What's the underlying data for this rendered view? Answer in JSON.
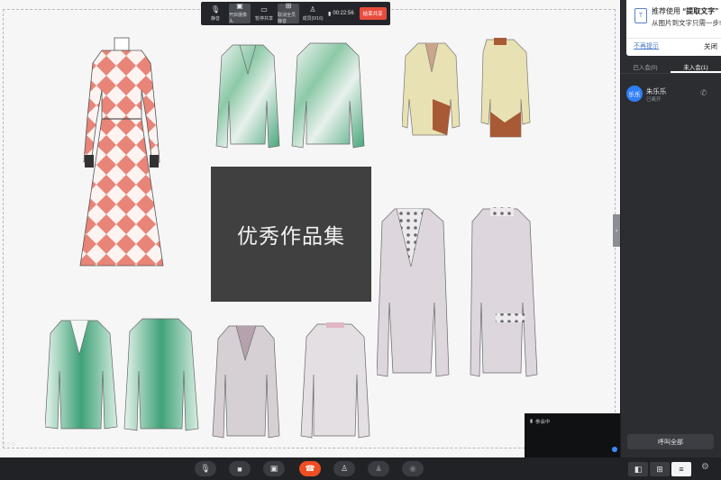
{
  "toolbar": {
    "buttons": [
      {
        "label": "静音",
        "icon": "mic-icon"
      },
      {
        "label": "开启摄像头",
        "icon": "camera-icon"
      },
      {
        "label": "暂停共享",
        "icon": "pause-share-icon"
      },
      {
        "label": "取消全员静音",
        "icon": "unmute-all-icon"
      },
      {
        "label": "成员(0/16)",
        "icon": "members-icon"
      }
    ],
    "timer": "00:22:56",
    "end_label": "结束共享"
  },
  "shared_screen": {
    "portfolio_title": "优秀作品集",
    "colors": {
      "card": "#404040",
      "coral": "#e88478",
      "green": "#3fa277",
      "beige": "#e8e1b3",
      "brown": "#a85a35",
      "mauve": "#c8bcc4"
    }
  },
  "video_tile": {
    "label": "参会中"
  },
  "promo": {
    "line1_prefix": "推荐使用",
    "line1_highlight": "“提取文字”",
    "line2": "从图片到文字只需一步!",
    "dismiss": "不再提示",
    "close": "关闭"
  },
  "panel": {
    "tabs": [
      {
        "label": "已入会(0)"
      },
      {
        "label": "未入会(1)"
      }
    ],
    "member": {
      "avatar_text": "乐乐",
      "name": "朱乐乐",
      "status": "已离开"
    },
    "call_all": "呼叫全部"
  },
  "bottombar": {
    "buttons": [
      "mic-icon",
      "camera-icon",
      "share-screen-icon",
      "hangup-icon",
      "add-member-icon",
      "members-icon",
      "record-icon"
    ],
    "view_modes": [
      "speaker-view-icon",
      "grid-view-icon",
      "list-view-icon"
    ]
  }
}
